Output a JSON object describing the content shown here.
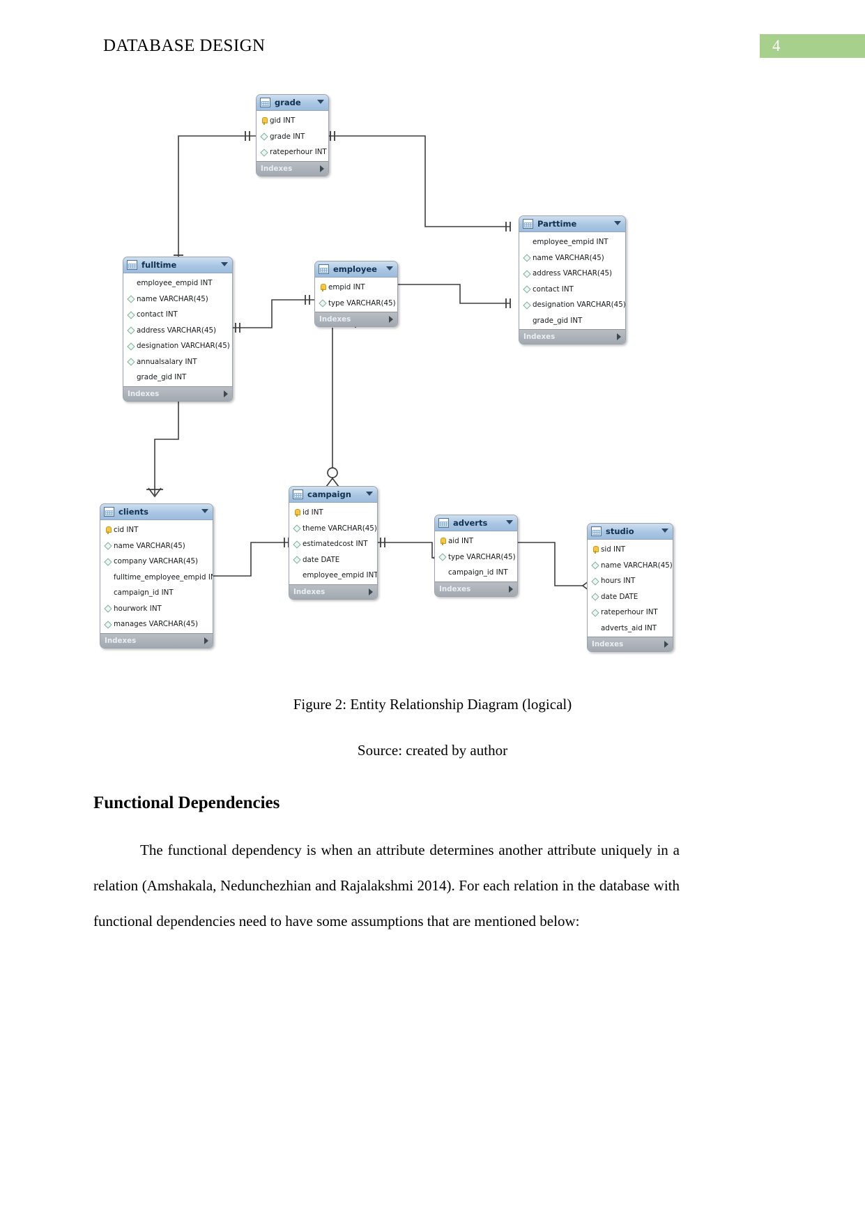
{
  "header": {
    "title": "DATABASE DESIGN",
    "page_number": "4",
    "page_number_bg": "#a8d08d"
  },
  "diagram": {
    "caption": "Figure 2: Entity Relationship Diagram (logical)",
    "source": "Source: created by author",
    "indexes_label": "Indexes",
    "tables": [
      {
        "name": "grade",
        "fields": [
          {
            "label": "gid INT",
            "key": "pk"
          },
          {
            "label": "grade INT",
            "key": "col"
          },
          {
            "label": "rateperhour INT",
            "key": "col"
          }
        ]
      },
      {
        "name": "fulltime",
        "fields": [
          {
            "label": "employee_empid INT",
            "key": "none"
          },
          {
            "label": "name VARCHAR(45)",
            "key": "col"
          },
          {
            "label": "contact INT",
            "key": "col"
          },
          {
            "label": "address VARCHAR(45)",
            "key": "col"
          },
          {
            "label": "designation VARCHAR(45)",
            "key": "col"
          },
          {
            "label": "annualsalary INT",
            "key": "col"
          },
          {
            "label": "grade_gid INT",
            "key": "none"
          }
        ]
      },
      {
        "name": "employee",
        "fields": [
          {
            "label": "empid INT",
            "key": "pk"
          },
          {
            "label": "type VARCHAR(45)",
            "key": "col"
          }
        ]
      },
      {
        "name": "Parttime",
        "fields": [
          {
            "label": "employee_empid INT",
            "key": "none"
          },
          {
            "label": "name VARCHAR(45)",
            "key": "col"
          },
          {
            "label": "address VARCHAR(45)",
            "key": "col"
          },
          {
            "label": "contact INT",
            "key": "col"
          },
          {
            "label": "designation VARCHAR(45)",
            "key": "col"
          },
          {
            "label": "grade_gid INT",
            "key": "none"
          }
        ]
      },
      {
        "name": "clients",
        "fields": [
          {
            "label": "cid INT",
            "key": "pk"
          },
          {
            "label": "name VARCHAR(45)",
            "key": "col"
          },
          {
            "label": "company VARCHAR(45)",
            "key": "col"
          },
          {
            "label": "fulltime_employee_empid INT",
            "key": "none"
          },
          {
            "label": "campaign_id INT",
            "key": "none"
          },
          {
            "label": "hourwork INT",
            "key": "col"
          },
          {
            "label": "manages VARCHAR(45)",
            "key": "col"
          }
        ]
      },
      {
        "name": "campaign",
        "fields": [
          {
            "label": "id INT",
            "key": "pk"
          },
          {
            "label": "theme VARCHAR(45)",
            "key": "col"
          },
          {
            "label": "estimatedcost INT",
            "key": "col"
          },
          {
            "label": "date DATE",
            "key": "col"
          },
          {
            "label": "employee_empid INT",
            "key": "none"
          }
        ]
      },
      {
        "name": "adverts",
        "fields": [
          {
            "label": "aid INT",
            "key": "pk"
          },
          {
            "label": "type VARCHAR(45)",
            "key": "col"
          },
          {
            "label": "campaign_id INT",
            "key": "none"
          }
        ]
      },
      {
        "name": "studio",
        "fields": [
          {
            "label": "sid INT",
            "key": "pk"
          },
          {
            "label": "name VARCHAR(45)",
            "key": "col"
          },
          {
            "label": "hours INT",
            "key": "col"
          },
          {
            "label": "date DATE",
            "key": "col"
          },
          {
            "label": "rateperhour INT",
            "key": "col"
          },
          {
            "label": "adverts_aid INT",
            "key": "none"
          }
        ]
      }
    ]
  },
  "body": {
    "heading": "Functional Dependencies",
    "paragraph": "The functional dependency is when an attribute determines another attribute uniquely in a relation (Amshakala, Nedunchezhian and Rajalakshmi 2014). For each relation in the database with functional dependencies need to have some assumptions that are mentioned below:"
  }
}
